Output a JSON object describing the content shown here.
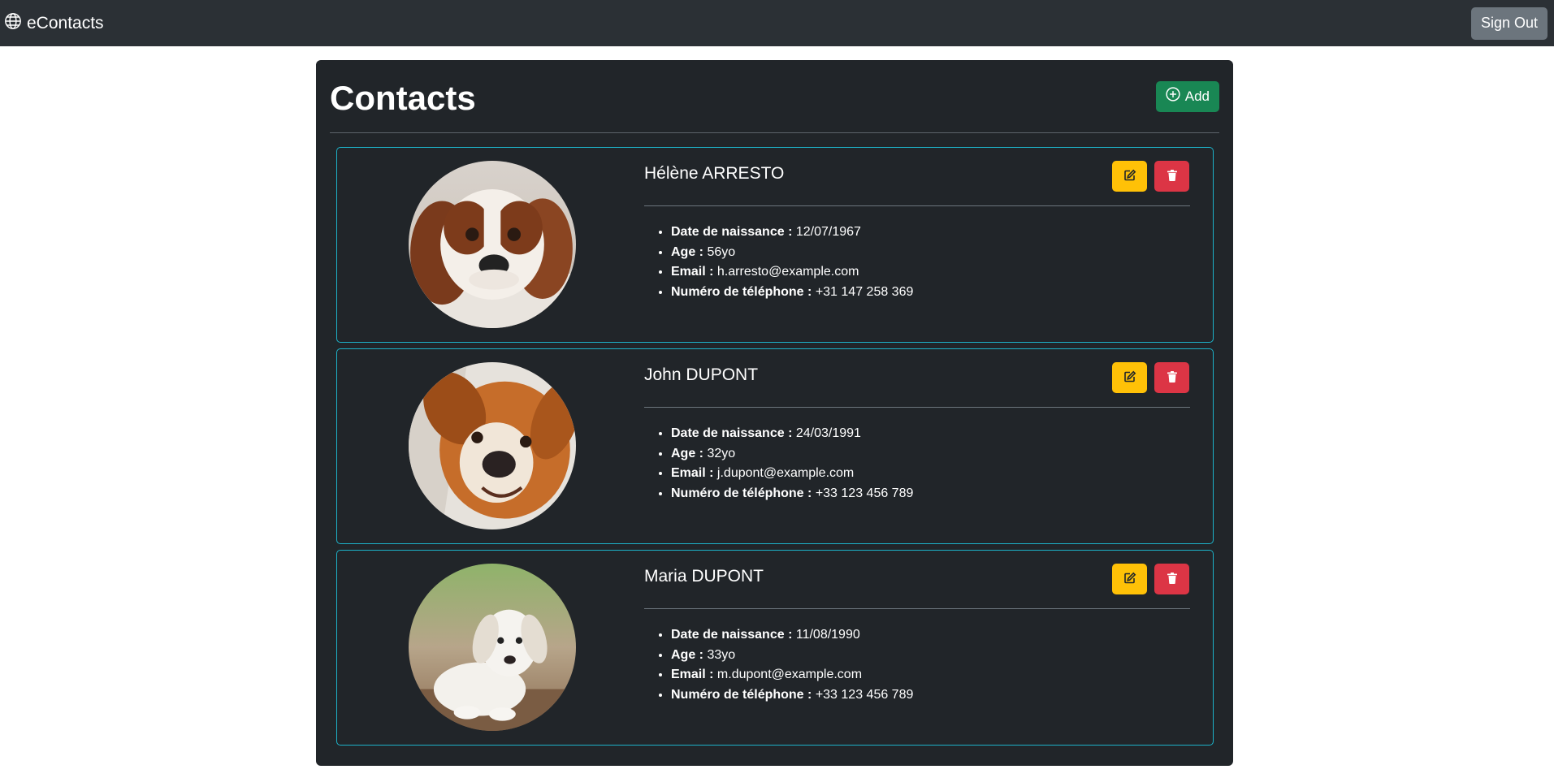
{
  "nav": {
    "brand": "eContacts",
    "brand_icon": "globe-icon",
    "signout_label": "Sign Out"
  },
  "page": {
    "title": "Contacts",
    "add_label": "Add",
    "add_icon": "plus-circle-icon"
  },
  "labels": {
    "birthdate": "Date de naissance :",
    "age": "Age :",
    "email": "Email :",
    "phone": "Numéro de téléphone :"
  },
  "contacts": [
    {
      "name": "Hélène ARRESTO",
      "birthdate": "12/07/1967",
      "age": "56yo",
      "email": "h.arresto@example.com",
      "phone": "+31 147 258 369"
    },
    {
      "name": "John DUPONT",
      "birthdate": "24/03/1991",
      "age": "32yo",
      "email": "j.dupont@example.com",
      "phone": "+33 123 456 789"
    },
    {
      "name": "Maria DUPONT",
      "birthdate": "11/08/1990",
      "age": "33yo",
      "email": "m.dupont@example.com",
      "phone": "+33 123 456 789"
    }
  ],
  "colors": {
    "navbar": "#2b3035",
    "panel": "#212529",
    "card_border": "#1db2c8",
    "add": "#198754",
    "edit": "#ffc107",
    "delete": "#dc3545",
    "signout": "#6c757d"
  }
}
